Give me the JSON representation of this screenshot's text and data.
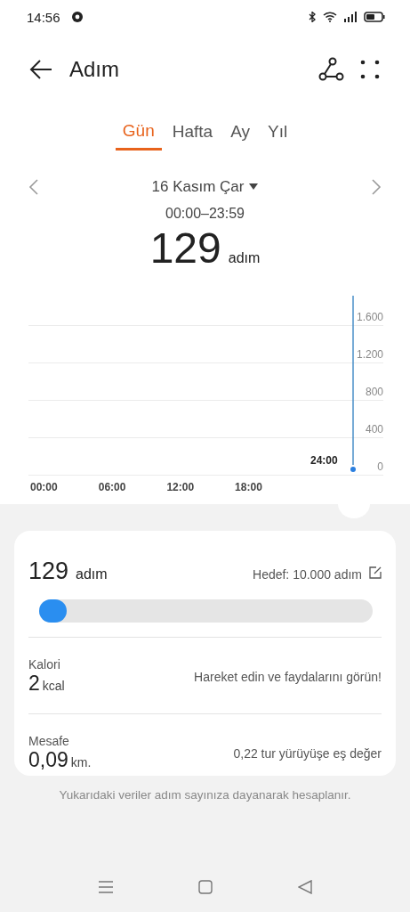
{
  "status_bar": {
    "time": "14:56"
  },
  "header": {
    "title": "Adım"
  },
  "tabs": [
    {
      "label": "Gün",
      "selected": true
    },
    {
      "label": "Hafta",
      "selected": false
    },
    {
      "label": "Ay",
      "selected": false
    },
    {
      "label": "Yıl",
      "selected": false
    }
  ],
  "date_nav": {
    "date": "16 Kasım Çar",
    "range": "00:00–23:59",
    "value": "129",
    "unit": "adım"
  },
  "chart": {
    "y_labels": [
      "1.600",
      "1.200",
      "800",
      "400",
      "0"
    ],
    "x_labels": [
      "00:00",
      "06:00",
      "12:00",
      "18:00"
    ],
    "cursor_label": "24:00"
  },
  "summary": {
    "value": "129",
    "unit": "adım",
    "goal": "Hedef: 10.000 adım",
    "level": 0.013
  },
  "metrics": [
    {
      "label": "Kalori",
      "value": "2",
      "unit": "kcal",
      "note": "Hareket edin ve faydalarını görün!"
    },
    {
      "label": "Mesafe",
      "value": "0,09",
      "unit": "km.",
      "note": "0,22 tur yürüyüşe eş değer"
    }
  ],
  "footnote": "Yukarıdaki veriler adım sayınıza dayanarak hesaplanır."
}
